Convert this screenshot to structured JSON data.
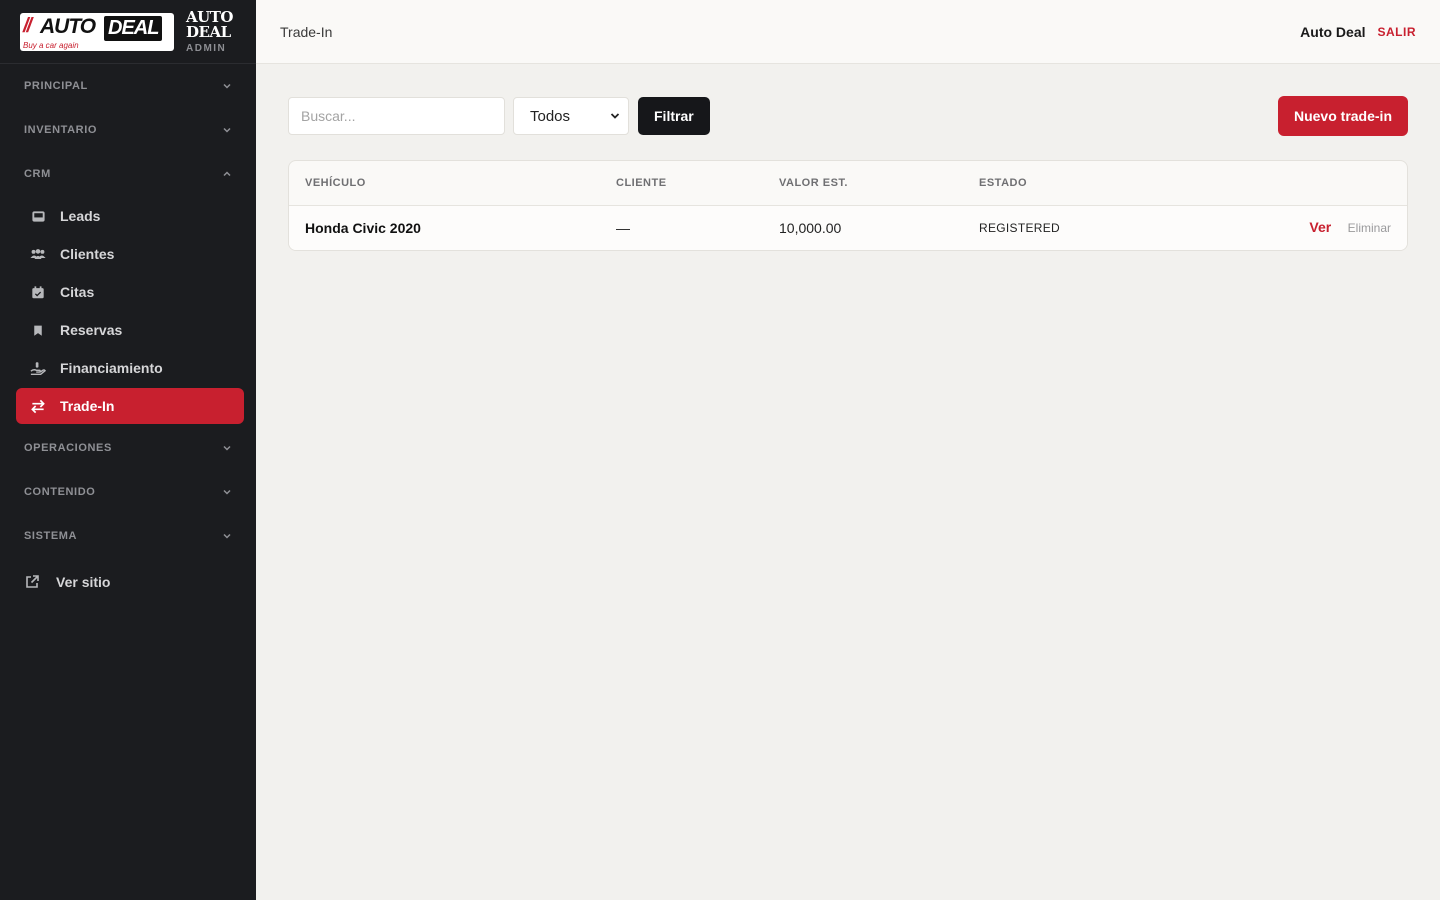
{
  "brand": {
    "logo_slash": "//",
    "logo_auto": "AUTO",
    "logo_deal": "DEAL",
    "logo_tagline": "Buy a car again",
    "title_line1": "AUTO",
    "title_line2": "DEAL",
    "subtitle": "ADMIN"
  },
  "sidebar": {
    "sections": {
      "principal": "PRINCIPAL",
      "inventario": "INVENTARIO",
      "crm": "CRM",
      "operaciones": "OPERACIONES",
      "contenido": "CONTENIDO",
      "sistema": "SISTEMA"
    },
    "crm_items": [
      {
        "label": "Leads",
        "icon": "inbox-icon"
      },
      {
        "label": "Clientes",
        "icon": "users-icon"
      },
      {
        "label": "Citas",
        "icon": "calendar-icon"
      },
      {
        "label": "Reservas",
        "icon": "bookmark-icon"
      },
      {
        "label": "Financiamiento",
        "icon": "hand-money-icon"
      },
      {
        "label": "Trade-In",
        "icon": "swap-arrows-icon",
        "active": true
      }
    ],
    "ver_sitio": "Ver sitio"
  },
  "topbar": {
    "title": "Trade-In",
    "user": "Auto Deal",
    "logout": "SALIR"
  },
  "filters": {
    "search_placeholder": "Buscar...",
    "status_selected": "Todos",
    "filter_button": "Filtrar",
    "new_button": "Nuevo trade-in"
  },
  "table": {
    "headers": [
      "VEHÍCULO",
      "CLIENTE",
      "VALOR EST.",
      "ESTADO"
    ],
    "rows": [
      {
        "vehicle": "Honda Civic 2020",
        "client": "—",
        "value": "10,000.00",
        "status": "REGISTERED",
        "view": "Ver",
        "delete": "Eliminar"
      }
    ]
  },
  "colors": {
    "accent": "#c8202f",
    "sidebar_bg": "#1b1c1f",
    "page_bg": "#f2f1ee"
  }
}
